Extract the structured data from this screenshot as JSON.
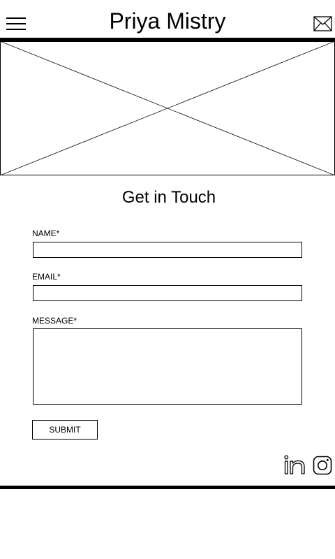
{
  "header": {
    "title": "Priya Mistry",
    "menu_icon": "hamburger-menu-icon",
    "mail_icon": "envelope-icon"
  },
  "hero": {
    "icon": "image-placeholder-icon"
  },
  "contact_form": {
    "heading": "Get in Touch",
    "name_label": "NAME*",
    "name_value": "",
    "email_label": "EMAIL*",
    "email_value": "",
    "message_label": "MESSAGE*",
    "message_value": "",
    "submit_label": "SUBMIT"
  },
  "footer": {
    "social_icons": [
      "linkedin-icon",
      "instagram-icon"
    ]
  },
  "colors": {
    "text": "#000000",
    "background": "#ffffff",
    "border": "#000000"
  }
}
